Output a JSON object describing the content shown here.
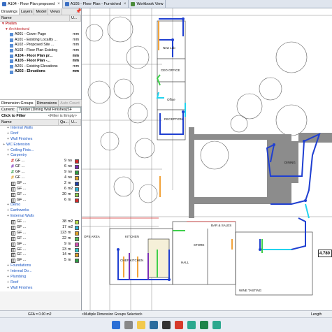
{
  "tabs": [
    {
      "label": "A104 - Floor Plan proposed"
    },
    {
      "label": "A105 - Floor Plan - Furnished"
    },
    {
      "label": "Workbook View"
    }
  ],
  "panel_tabs": [
    "Drawings",
    "Layers",
    "Model",
    "Views"
  ],
  "drawings_header": {
    "name": "Name",
    "units": "U..."
  },
  "drawings": {
    "project": "Prelim",
    "group": "Architectural",
    "sheets": [
      {
        "label": "A001 - Cover Page",
        "unit": "mm",
        "style": ""
      },
      {
        "label": "A101 - Existing Locality ...",
        "unit": "mm",
        "style": ""
      },
      {
        "label": "A102 - Proposed Site ...",
        "unit": "mm",
        "style": ""
      },
      {
        "label": "A103 - Floor Plan Existing",
        "unit": "mm",
        "style": ""
      },
      {
        "label": "A104 - Floor Plan pr...",
        "unit": "mm",
        "style": "bold"
      },
      {
        "label": "A105 - Floor Plan -...",
        "unit": "mm",
        "style": "bold"
      },
      {
        "label": "A201 - Existing Elevations",
        "unit": "mm",
        "style": ""
      },
      {
        "label": "A202 - Elevations",
        "unit": "mm",
        "style": "bold"
      }
    ]
  },
  "bottom_tabs": [
    "Dimension Groups",
    "Dimensions",
    "Auto Count"
  ],
  "filter": {
    "label": "Click to Filter",
    "empty": "<Filter is Empty>"
  },
  "current": {
    "label": "Current:",
    "value": "Tender (Dining Wall Finishes)SF"
  },
  "dg_header": {
    "name": "Name",
    "q": "Qu...",
    "u": "U..."
  },
  "dim_groups": [
    {
      "indent": 1,
      "label": "Internal Walls",
      "color": "",
      "type": "folder",
      "q": "",
      "u": ""
    },
    {
      "indent": 1,
      "label": "Roof",
      "color": "",
      "type": "folder",
      "q": "",
      "u": ""
    },
    {
      "indent": 1,
      "label": "Wall Finishes",
      "color": "",
      "type": "folder",
      "q": "",
      "u": ""
    },
    {
      "indent": 0,
      "label": "WC Extension",
      "color": "",
      "type": "folder",
      "q": "",
      "u": ""
    },
    {
      "indent": 1,
      "label": "Ceiling Finis...",
      "color": "",
      "type": "folder",
      "q": "",
      "u": ""
    },
    {
      "indent": 1,
      "label": "Carpentry",
      "color": "",
      "type": "folder",
      "q": "",
      "u": ""
    },
    {
      "indent": 2,
      "label": "GF ...",
      "color": "#d62b2b",
      "type": "hash",
      "q": "9",
      "u": "no"
    },
    {
      "indent": 2,
      "label": "GF ...",
      "color": "#7a2fb8",
      "type": "hash",
      "q": "6",
      "u": "no"
    },
    {
      "indent": 2,
      "label": "GF ...",
      "color": "#2f9e44",
      "type": "hash",
      "q": "9",
      "u": "no"
    },
    {
      "indent": 2,
      "label": "GF ...",
      "color": "#e0a22a",
      "type": "hash",
      "q": "4",
      "u": "no"
    },
    {
      "indent": 2,
      "label": "GF ...",
      "color": "#1f3fa6",
      "type": "grid",
      "q": "2",
      "u": "m"
    },
    {
      "indent": 2,
      "label": "GF ...",
      "color": "#2bb4d6",
      "type": "grid",
      "q": "6",
      "u": "m2"
    },
    {
      "indent": 2,
      "label": "GF ...",
      "color": "#8fd14f",
      "type": "grid",
      "q": "20",
      "u": "m"
    },
    {
      "indent": 2,
      "label": "GF ...",
      "color": "#d62b2b",
      "type": "grid",
      "q": "6",
      "u": "m"
    },
    {
      "indent": 1,
      "label": "Demo",
      "color": "",
      "type": "folder",
      "q": "",
      "u": ""
    },
    {
      "indent": 1,
      "label": "Earthworks",
      "color": "",
      "type": "folder",
      "q": "",
      "u": ""
    },
    {
      "indent": 1,
      "label": "External Walls",
      "color": "",
      "type": "folder",
      "q": "",
      "u": ""
    },
    {
      "indent": 2,
      "label": "GF ...",
      "color": "#b7e04a",
      "type": "grid",
      "q": "38",
      "u": "m2"
    },
    {
      "indent": 2,
      "label": "GF ...",
      "color": "#2bb4d6",
      "type": "grid",
      "q": "17",
      "u": "m2"
    },
    {
      "indent": 2,
      "label": "GF ...",
      "color": "#e0a22a",
      "type": "grid",
      "q": "123",
      "u": "m"
    },
    {
      "indent": 2,
      "label": "GF ...",
      "color": "#4fc25a",
      "type": "grid",
      "q": "22",
      "u": "m"
    },
    {
      "indent": 2,
      "label": "GF ...",
      "color": "#d14fb0",
      "type": "grid",
      "q": "9",
      "u": "m"
    },
    {
      "indent": 2,
      "label": "GF ...",
      "color": "#28c8c8",
      "type": "grid",
      "q": "23",
      "u": "m"
    },
    {
      "indent": 2,
      "label": "GF ...",
      "color": "#e0a22a",
      "type": "grid",
      "q": "14",
      "u": "m"
    },
    {
      "indent": 2,
      "label": "GF ...",
      "color": "#2f9e44",
      "type": "grid",
      "q": "5",
      "u": "m"
    },
    {
      "indent": 1,
      "label": "Foundations",
      "color": "",
      "type": "folder",
      "q": "",
      "u": ""
    },
    {
      "indent": 1,
      "label": "Internal Do...",
      "color": "",
      "type": "folder",
      "q": "",
      "u": ""
    },
    {
      "indent": 1,
      "label": "Plumbing",
      "color": "",
      "type": "folder",
      "q": "",
      "u": ""
    },
    {
      "indent": 1,
      "label": "Roof",
      "color": "",
      "type": "folder",
      "q": "",
      "u": ""
    },
    {
      "indent": 1,
      "label": "Wall Finishes",
      "color": "",
      "type": "folder",
      "q": "",
      "u": ""
    }
  ],
  "plan_labels": {
    "new_lab": "New Lab",
    "ceo_office": "CEO OFFICE",
    "office": "Office",
    "reception": "RECEPTION",
    "dining": "DINING",
    "bar_sales": "BAR & SALES",
    "store": "STORE",
    "kitchen": "KITCHEN",
    "chef_kitchen": "CHEF KITCHEN",
    "ops_area": "OPS AREA",
    "hall": "HALL",
    "wine_tasting": "WINE TASTING"
  },
  "measure_box": "4.780",
  "status": {
    "gfa": "GFA = 0.00 m2",
    "groups": "<Multiple Dimension Groups Selected>",
    "length": "Length"
  },
  "colors": {
    "blue_line": "#1f3fd1",
    "cyan_line": "#22d3ee",
    "green_line": "#3ecf4a",
    "orange_line": "#f2a33a",
    "purple": "#7a2fb8"
  }
}
